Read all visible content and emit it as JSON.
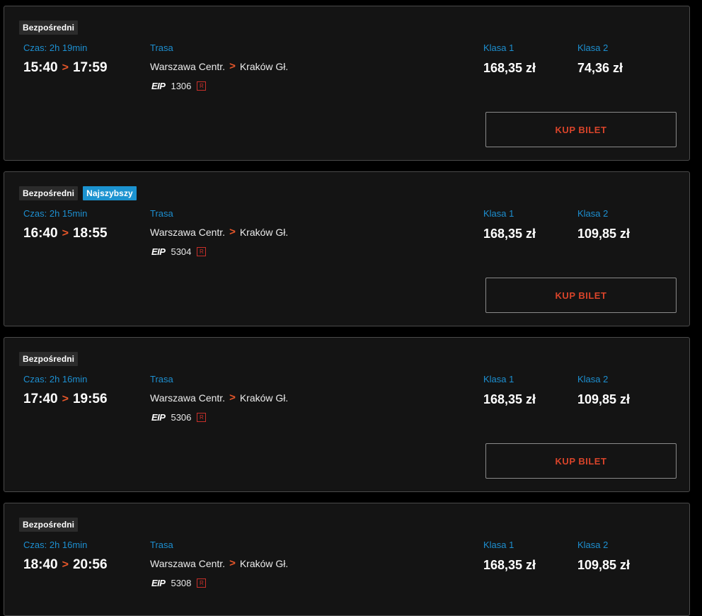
{
  "ui": {
    "route_label": "Trasa",
    "class1_label": "Klasa 1",
    "class2_label": "Klasa 2",
    "buy_label": "KUP BILET",
    "arrow_glyph": ">",
    "carrier": "EIP",
    "ticket_flag": "R"
  },
  "colors": {
    "accent_blue": "#1d8fd0",
    "accent_orange": "#e8572a",
    "buy_text": "#d9442a",
    "background": "#141414"
  },
  "connections": [
    {
      "badges": [
        "Bezpośredni"
      ],
      "fastest": "",
      "duration": "Czas: 2h 19min",
      "departure": "15:40",
      "arrival": "17:59",
      "from": "Warszawa Centr.",
      "to": "Kraków Gł.",
      "train_number": "1306",
      "class1_price": "168,35 zł",
      "class2_price": "74,36 zł"
    },
    {
      "badges": [
        "Bezpośredni"
      ],
      "fastest": "Najszybszy",
      "duration": "Czas: 2h 15min",
      "departure": "16:40",
      "arrival": "18:55",
      "from": "Warszawa Centr.",
      "to": "Kraków Gł.",
      "train_number": "5304",
      "class1_price": "168,35 zł",
      "class2_price": "109,85 zł"
    },
    {
      "badges": [
        "Bezpośredni"
      ],
      "fastest": "",
      "duration": "Czas: 2h 16min",
      "departure": "17:40",
      "arrival": "19:56",
      "from": "Warszawa Centr.",
      "to": "Kraków Gł.",
      "train_number": "5306",
      "class1_price": "168,35 zł",
      "class2_price": "109,85 zł"
    },
    {
      "badges": [
        "Bezpośredni"
      ],
      "fastest": "",
      "duration": "Czas: 2h 16min",
      "departure": "18:40",
      "arrival": "20:56",
      "from": "Warszawa Centr.",
      "to": "Kraków Gł.",
      "train_number": "5308",
      "class1_price": "168,35 zł",
      "class2_price": "109,85 zł"
    }
  ]
}
